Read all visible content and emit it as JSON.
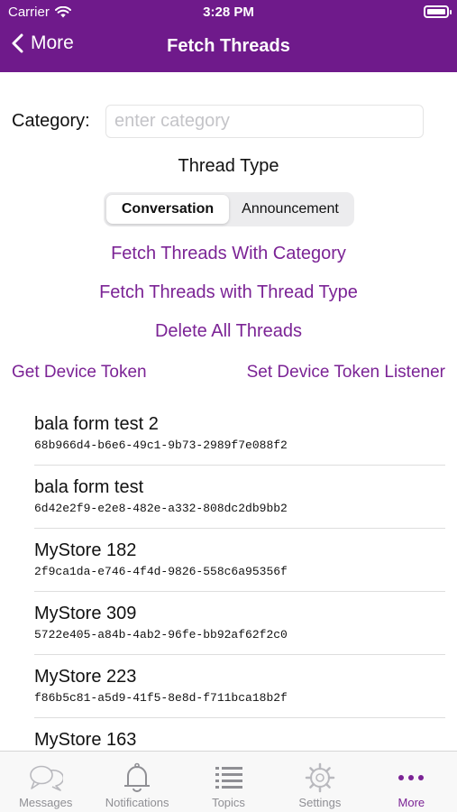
{
  "status_bar": {
    "carrier": "Carrier",
    "time": "3:28 PM",
    "battery_level": 1.0
  },
  "nav": {
    "back_label": "More",
    "title": "Fetch Threads"
  },
  "category": {
    "label": "Category:",
    "placeholder": "enter category",
    "value": ""
  },
  "thread_type": {
    "label": "Thread Type",
    "options": [
      "Conversation",
      "Announcement"
    ],
    "selected": "Conversation"
  },
  "actions": {
    "fetch_with_category": "Fetch Threads With Category",
    "fetch_with_type": "Fetch Threads with Thread Type",
    "delete_all": "Delete All Threads",
    "get_device_token": "Get Device Token",
    "set_token_listener": "Set Device Token Listener"
  },
  "threads": [
    {
      "name": "bala form test 2",
      "id": "68b966d4-b6e6-49c1-9b73-2989f7e088f2"
    },
    {
      "name": "bala form test",
      "id": "6d42e2f9-e2e8-482e-a332-808dc2db9bb2"
    },
    {
      "name": "MyStore 182",
      "id": "2f9ca1da-e746-4f4d-9826-558c6a95356f"
    },
    {
      "name": "MyStore 309",
      "id": "5722e405-a84b-4ab2-96fe-bb92af62f2c0"
    },
    {
      "name": "MyStore 223",
      "id": "f86b5c81-a5d9-41f5-8e8d-f711bca18b2f"
    },
    {
      "name": "MyStore 163",
      "id": ""
    }
  ],
  "tabbar": {
    "items": [
      {
        "label": "Messages",
        "icon": "chat-bubbles-icon"
      },
      {
        "label": "Notifications",
        "icon": "bell-icon"
      },
      {
        "label": "Topics",
        "icon": "list-icon"
      },
      {
        "label": "Settings",
        "icon": "gear-icon"
      },
      {
        "label": "More",
        "icon": "more-dots-icon"
      }
    ],
    "active": "More"
  },
  "colors": {
    "brand": "#6f1a8b",
    "link": "#7b2395",
    "tab_inactive": "#8f8f94"
  }
}
